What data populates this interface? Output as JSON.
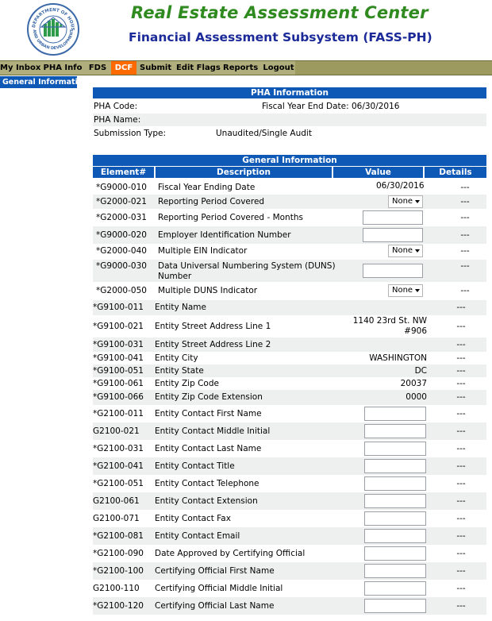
{
  "header": {
    "title": "Real Estate Assessment Center",
    "subtitle": "Financial Assessment Subsystem (FASS-PH)",
    "seal_top_text": "U.S. DEPARTMENT OF HOUSING",
    "seal_bottom_text": "AND URBAN DEVELOPMENT"
  },
  "nav": {
    "tabs": [
      "My Inbox",
      "PHA Info",
      "FDS",
      "DCF",
      "Submit",
      "Edit Flags",
      "Reports",
      "Logout"
    ],
    "active": "DCF"
  },
  "sidebar": {
    "item": "General Information"
  },
  "pha": {
    "section_title": "PHA Information",
    "code_label": "PHA Code:",
    "fye_text": "Fiscal Year End Date: 06/30/2016",
    "name_label": "PHA Name:",
    "submission_label": "Submission Type:",
    "submission_value": "Unaudited/Single Audit"
  },
  "general": {
    "section_title": "General Information",
    "columns": [
      "Element#",
      "Description",
      "Value",
      "Details"
    ],
    "rows": [
      {
        "code": "*G9000-010",
        "desc": "Fiscal Year Ending Date",
        "value": "06/30/2016",
        "details": "---"
      },
      {
        "code": "*G2000-021",
        "desc": "Reporting Period Covered",
        "value": "None",
        "details": "---"
      },
      {
        "code": "*G2000-031",
        "desc": "Reporting Period Covered - Months",
        "value": "",
        "details": "---"
      },
      {
        "code": "*G9000-020",
        "desc": "Employer Identification Number",
        "value": "",
        "details": "---"
      },
      {
        "code": "*G2000-040",
        "desc": "Multiple EIN Indicator",
        "value": "None",
        "details": "---"
      },
      {
        "code": "*G9000-030",
        "desc": "Data Universal Numbering System (DUNS)",
        "desc2": "Number",
        "value": "",
        "details": "---"
      },
      {
        "code": "*G2000-050",
        "desc": "Multiple DUNS Indicator",
        "value": "None",
        "details": "---"
      },
      {
        "code": "*G9100-011",
        "desc": "Entity Name",
        "value": "",
        "details": "---"
      },
      {
        "code": "*G9100-021",
        "desc": "Entity Street Address Line 1",
        "value": "1140 23rd St. NW",
        "value2": "#906",
        "details": "---"
      },
      {
        "code": "*G9100-031",
        "desc": "Entity Street Address Line 2",
        "value": "",
        "details": "---"
      },
      {
        "code": "*G9100-041",
        "desc": "Entity City",
        "value": "WASHINGTON",
        "details": "---"
      },
      {
        "code": "*G9100-051",
        "desc": "Entity State",
        "value": "DC",
        "details": "---"
      },
      {
        "code": "*G9100-061",
        "desc": "Entity Zip Code",
        "value": "20037",
        "details": "---"
      },
      {
        "code": "*G9100-066",
        "desc": "Entity Zip Code Extension",
        "value": "0000",
        "details": "---"
      },
      {
        "code": "*G2100-011",
        "desc": "Entity Contact First Name",
        "value": "",
        "details": "---"
      },
      {
        "code": "G2100-021",
        "desc": "Entity Contact Middle Initial",
        "value": "",
        "details": "---"
      },
      {
        "code": "*G2100-031",
        "desc": "Entity Contact Last Name",
        "value": "",
        "details": "---"
      },
      {
        "code": "*G2100-041",
        "desc": "Entity Contact Title",
        "value": "",
        "details": "---"
      },
      {
        "code": "*G2100-051",
        "desc": "Entity Contact Telephone",
        "value": "",
        "details": "---"
      },
      {
        "code": "G2100-061",
        "desc": "Entity Contact Extension",
        "value": "",
        "details": "---"
      },
      {
        "code": "G2100-071",
        "desc": "Entity Contact Fax",
        "value": "",
        "details": "---"
      },
      {
        "code": "*G2100-081",
        "desc": "Entity Contact Email",
        "value": "",
        "details": "---"
      },
      {
        "code": "*G2100-090",
        "desc": "Date Approved by Certifying Official",
        "value": "",
        "details": "---"
      },
      {
        "code": "*G2100-100",
        "desc": "Certifying Official First Name",
        "value": "",
        "details": "---"
      },
      {
        "code": "G2100-110",
        "desc": "Certifying Official Middle Initial",
        "value": "",
        "details": "---"
      },
      {
        "code": "*G2100-120",
        "desc": "Certifying Official Last Name",
        "value": "",
        "details": "---"
      }
    ]
  },
  "colors": {
    "brand_blue": "#0f59b6",
    "nav_olive": "#9d9a5f",
    "active_tab": "#ff6a00",
    "title_green": "#2f8a1f",
    "title_navy": "#1b2a98"
  }
}
